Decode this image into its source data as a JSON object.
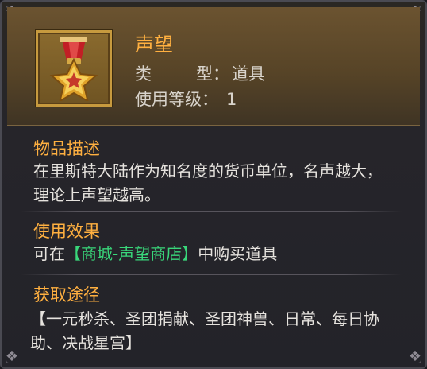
{
  "item": {
    "name": "声望",
    "type_label_a": "类",
    "type_label_b": "型：",
    "type_value": "道具",
    "level_label": "使用等级：",
    "level_value": "1"
  },
  "sections": {
    "description": {
      "title": "物品描述",
      "text": "在里斯特大陆作为知名度的货币单位，名声越大，理论上声望越高。"
    },
    "usage": {
      "title": "使用效果",
      "prefix": "可在",
      "link": "【商城-声望商店】",
      "suffix": "中购买道具"
    },
    "source": {
      "title": "获取途径",
      "text": "【一元秒杀、圣团捐献、圣团神兽、日常、每日协助、决战星宫】"
    }
  },
  "icons": {
    "item_icon": "star-medal-icon",
    "corner_ornament": "ornament-icon"
  },
  "colors": {
    "title_orange": "#ffb040",
    "link_green": "#39d67a",
    "frame_gold": "#c79a3e"
  }
}
